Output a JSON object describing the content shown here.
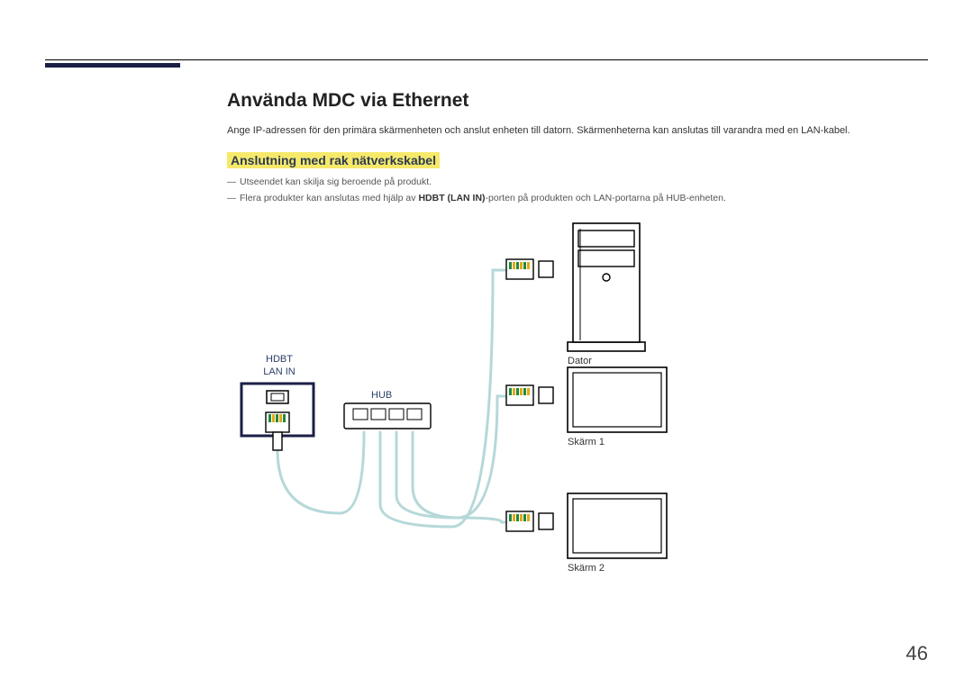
{
  "heading": "Använda MDC via Ethernet",
  "intro": "Ange IP-adressen för den primära skärmenheten och anslut enheten till datorn. Skärmenheterna kan anslutas till varandra med en LAN-kabel.",
  "subheading": "Anslutning med rak nätverkskabel",
  "notes": {
    "n1": "Utseendet kan skilja sig beroende på produkt.",
    "n2_pre": "Flera produkter kan anslutas med hjälp av ",
    "n2_bold": "HDBT (LAN IN)",
    "n2_post": "-porten på produkten och LAN-portarna på HUB-enheten."
  },
  "labels": {
    "hdbt": "HDBT\nLAN IN",
    "hub": "HUB",
    "dator": "Dator",
    "skarm1": "Skärm 1",
    "skarm2": "Skärm 2"
  },
  "page": "46"
}
